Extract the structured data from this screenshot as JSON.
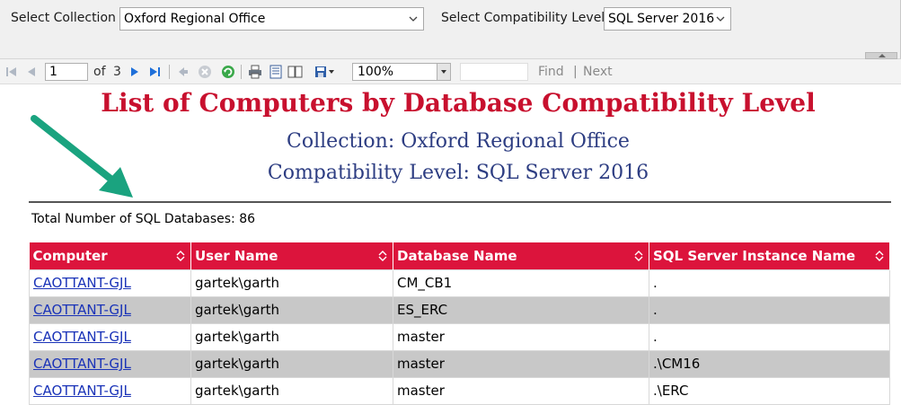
{
  "params": {
    "collection_label": "Select Collection",
    "collection_value": "Oxford Regional Office",
    "compat_label": "Select Compatibility Level",
    "compat_value": "SQL Server 2016"
  },
  "toolbar": {
    "page_current": "1",
    "page_of": "of",
    "page_total": "3",
    "zoom": "100%",
    "find_label": "Find",
    "separator": "|",
    "next_label": "Next"
  },
  "report": {
    "title": "List of Computers by Database Compatibility Level",
    "collection_line": "Collection: Oxford Regional Office",
    "compat_line": "Compatibility Level: SQL Server 2016",
    "total_label": "Total Number of SQL Databases: 86"
  },
  "table": {
    "headers": [
      "Computer",
      "User Name",
      "Database Name",
      "SQL Server Instance Name"
    ],
    "rows": [
      {
        "computer": "CAOTTANT-GJL",
        "user": "gartek\\garth",
        "database": "CM_CB1",
        "instance": "."
      },
      {
        "computer": "CAOTTANT-GJL",
        "user": "gartek\\garth",
        "database": "ES_ERC",
        "instance": "."
      },
      {
        "computer": "CAOTTANT-GJL",
        "user": "gartek\\garth",
        "database": "master",
        "instance": "."
      },
      {
        "computer": "CAOTTANT-GJL",
        "user": "gartek\\garth",
        "database": "master",
        "instance": ".\\CM16"
      },
      {
        "computer": "CAOTTANT-GJL",
        "user": "gartek\\garth",
        "database": "master",
        "instance": ".\\ERC"
      }
    ]
  },
  "colors": {
    "title_red": "#c8102e",
    "subtitle_blue": "#2d3d82",
    "header_red": "#dc143c",
    "arrow_green": "#1aa37f"
  },
  "icons": [
    "first-page-icon",
    "previous-page-icon",
    "next-page-icon",
    "last-page-icon",
    "back-icon",
    "stop-icon",
    "refresh-icon",
    "print-icon",
    "print-layout-icon",
    "page-setup-icon",
    "export-icon"
  ]
}
